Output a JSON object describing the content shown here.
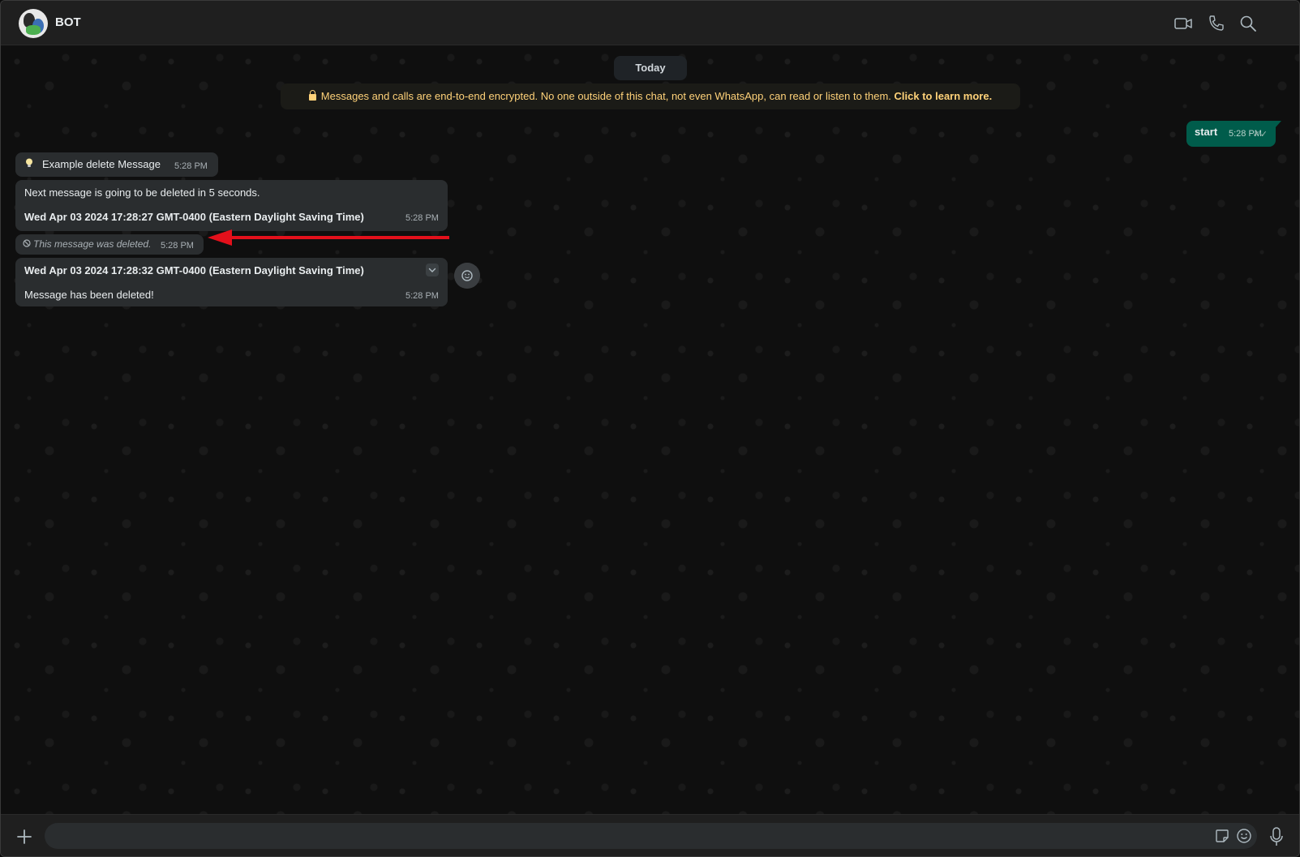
{
  "header": {
    "contact_name": "BOT",
    "icons": [
      "video-call-icon",
      "voice-call-icon",
      "search-icon"
    ]
  },
  "chat": {
    "date_separator": "Today",
    "encryption_notice": "Messages and calls are end-to-end encrypted. No one outside of this chat, not even WhatsApp, can read or listen to them.",
    "encryption_link": "Click to learn more.",
    "messages": [
      {
        "direction": "outgoing",
        "text": "start",
        "time": "5:28 PM",
        "status": "read"
      },
      {
        "direction": "incoming",
        "text": "Example delete Message",
        "time": "5:28 PM",
        "icon": "lightbulb-icon"
      },
      {
        "direction": "incoming",
        "line1": "Next message is going to be deleted in 5 seconds.",
        "line2": "Wed Apr 03 2024 17:28:27 GMT-0400 (Eastern Daylight Saving Time)",
        "time": "5:28 PM"
      },
      {
        "direction": "incoming",
        "text": "This message was deleted.",
        "time": "5:28 PM",
        "deleted": true
      },
      {
        "direction": "incoming",
        "line1": "Wed Apr 03 2024 17:28:32 GMT-0400 (Eastern Daylight Saving Time)",
        "line2": "Message has been deleted!",
        "time": "5:28 PM"
      }
    ]
  },
  "annotation": {
    "color": "#e3101b",
    "type": "arrow",
    "points_to": "deleted-message"
  },
  "composer": {
    "value": "",
    "placeholder": ""
  },
  "colors": {
    "outgoing_bubble": "#005c4b",
    "incoming_bubble": "#2a2d2f",
    "encryption_text": "#ffd279",
    "header": "#1f1f1f"
  }
}
